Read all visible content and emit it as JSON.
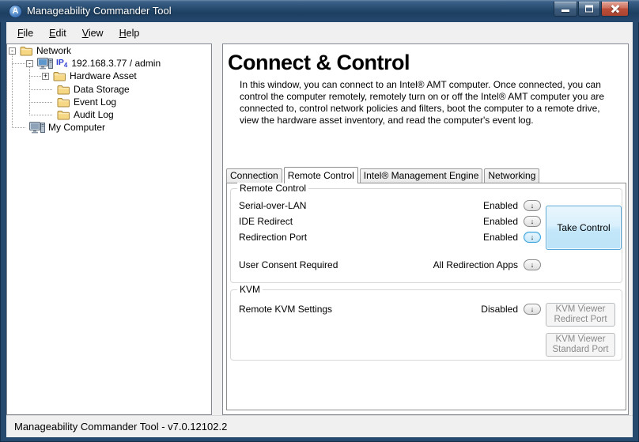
{
  "window": {
    "title": "Manageability Commander Tool"
  },
  "icons": {
    "app_letter": "A",
    "dropdown_glyph": "↓",
    "expander_expanded": "-",
    "expander_collapsed": "+"
  },
  "menu": {
    "items": [
      {
        "label": "File"
      },
      {
        "label": "Edit"
      },
      {
        "label": "View"
      },
      {
        "label": "Help"
      }
    ]
  },
  "tree": {
    "nodes": [
      {
        "label": "Network"
      },
      {
        "prefix": "IP",
        "prefix_sub": "4",
        "label": "192.168.3.77 / admin"
      },
      {
        "label": "Hardware Asset"
      },
      {
        "label": "Data Storage"
      },
      {
        "label": "Event Log"
      },
      {
        "label": "Audit Log"
      },
      {
        "label": "My Computer"
      }
    ]
  },
  "main": {
    "heading": "Connect & Control",
    "description": "In this window, you can connect to an Intel® AMT computer. Once connected, you can control the computer remotely, remotely turn on or off the Intel® AMT computer you are connected to, control network policies and filters, boot the computer to a remote drive, view the hardware asset inventory, and read the computer's event log.",
    "tabs": [
      {
        "label": "Connection"
      },
      {
        "label": "Remote Control"
      },
      {
        "label": "Intel® Management Engine"
      },
      {
        "label": "Networking"
      }
    ],
    "remote_control_group": {
      "label": "Remote Control",
      "rows": [
        {
          "label": "Serial-over-LAN",
          "value": "Enabled"
        },
        {
          "label": "IDE Redirect",
          "value": "Enabled"
        },
        {
          "label": "Redirection Port",
          "value": "Enabled"
        },
        {
          "label": "User Consent Required",
          "value": "All Redirection Apps"
        }
      ],
      "take_control_button": "Take Control"
    },
    "kvm_group": {
      "label": "KVM",
      "rows": [
        {
          "label": "Remote KVM Settings",
          "value": "Disabled"
        }
      ],
      "buttons": [
        {
          "label": "KVM Viewer\nRedirect Port"
        },
        {
          "label": "KVM Viewer\nStandard Port"
        }
      ]
    }
  },
  "statusbar": {
    "text": "Manageability Commander Tool - v7.0.12102.2"
  },
  "colors": {
    "titlebar": "#224769",
    "client_bg": "#F0F0F0",
    "panel_border": "#828790",
    "highlight_blue_border": "#56A7D8",
    "highlight_blue_fill": "#CDE9F8",
    "close_button_red": "#BC4F3A",
    "ip_label_blue": "#2F3FD0",
    "folder_yellow": "#F6D884",
    "disabled_text": "#8A8A8A"
  }
}
